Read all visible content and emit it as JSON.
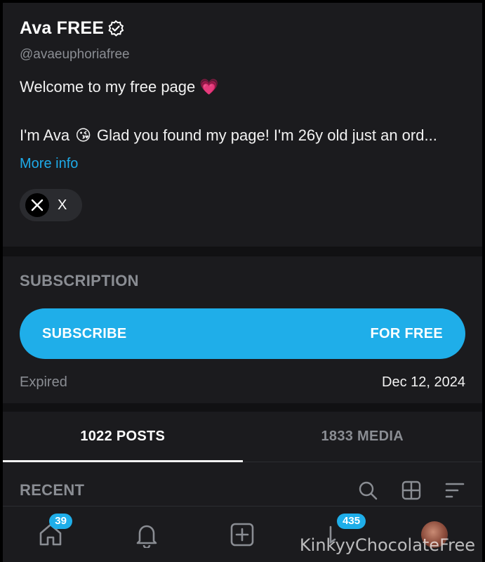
{
  "profile": {
    "name": "Ava FREE",
    "handle": "@avaeuphoriafree",
    "bio_line1": "Welcome to my free page",
    "bio_line1_emoji": "💗",
    "bio_line2_a": "I'm Ava",
    "bio_line2_emoji": "😘",
    "bio_line2_b": "Glad you found my page! I'm 26y old just an ord...",
    "more_info": "More info",
    "social": {
      "label": "X",
      "icon": "x-logo-icon"
    }
  },
  "subscription": {
    "title": "SUBSCRIPTION",
    "button_left": "SUBSCRIBE",
    "button_right": "FOR FREE",
    "status_label": "Expired",
    "status_date": "Dec 12, 2024",
    "accent": "#1faee9"
  },
  "tabs": [
    {
      "label": "1022 POSTS",
      "active": true
    },
    {
      "label": "1833 MEDIA",
      "active": false
    }
  ],
  "recent": {
    "title": "RECENT",
    "icons": [
      "search-icon",
      "grid-icon",
      "sort-icon"
    ]
  },
  "bottom_nav": {
    "home_badge": "39",
    "messages_badge": "435",
    "icons": [
      "home-icon",
      "bell-icon",
      "add-post-icon",
      "messages-icon",
      "avatar"
    ]
  },
  "watermark": "KinkyyChocolateFree"
}
